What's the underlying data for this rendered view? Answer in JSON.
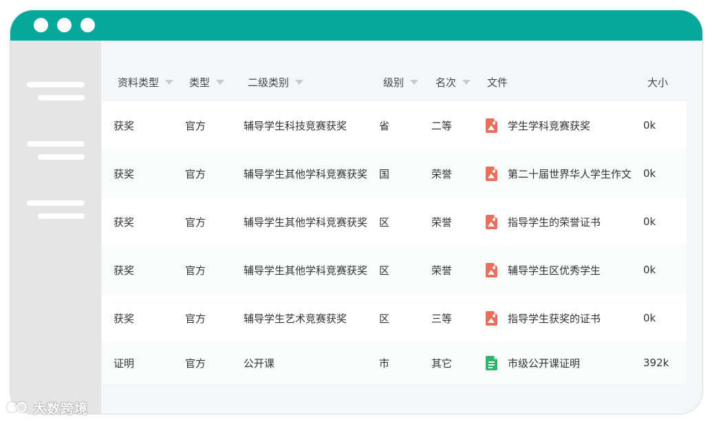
{
  "table": {
    "headers": [
      {
        "label": "资料类型",
        "sortable": true
      },
      {
        "label": "类型",
        "sortable": true
      },
      {
        "label": "二级类别",
        "sortable": true
      },
      {
        "label": "级别",
        "sortable": true
      },
      {
        "label": "名次",
        "sortable": true
      },
      {
        "label": "文件",
        "sortable": false
      },
      {
        "label": "大小",
        "sortable": false
      }
    ],
    "rows": [
      {
        "material_type": "获奖",
        "type": "官方",
        "subcategory": "辅导学生科技竞赛获奖",
        "level": "省",
        "rank": "二等",
        "file_icon": "image-file-icon",
        "file": "学生学科竞赛获奖",
        "size": "0k"
      },
      {
        "material_type": "获奖",
        "type": "官方",
        "subcategory": "辅导学生其他学科竞赛获奖",
        "level": "国",
        "rank": "荣誉",
        "file_icon": "image-file-icon",
        "file": "第二十届世界华人学生作文",
        "size": "0k"
      },
      {
        "material_type": "获奖",
        "type": "官方",
        "subcategory": "辅导学生其他学科竞赛获奖",
        "level": "区",
        "rank": "荣誉",
        "file_icon": "image-file-icon",
        "file": "指导学生的荣誉证书",
        "size": "0k"
      },
      {
        "material_type": "获奖",
        "type": "官方",
        "subcategory": "辅导学生其他学科竞赛获奖",
        "level": "区",
        "rank": "荣誉",
        "file_icon": "image-file-icon",
        "file": "辅导学生区优秀学生",
        "size": "0k"
      },
      {
        "material_type": "获奖",
        "type": "官方",
        "subcategory": "辅导学生艺术竞赛获奖",
        "level": "区",
        "rank": "三等",
        "file_icon": "image-file-icon",
        "file": "指导学生获奖的证书",
        "size": "0k"
      },
      {
        "material_type": "证明",
        "type": "官方",
        "subcategory": "公开课",
        "level": "市",
        "rank": "其它",
        "file_icon": "doc-file-icon",
        "file": "市级公开课证明",
        "size": "392k"
      }
    ]
  },
  "watermark": {
    "text": "大数跨境"
  },
  "colors": {
    "titlebar": "#04a99c",
    "sidebar": "#e5e5e5",
    "image_file_icon": "#ea6f5a",
    "doc_file_icon": "#2db46d"
  }
}
